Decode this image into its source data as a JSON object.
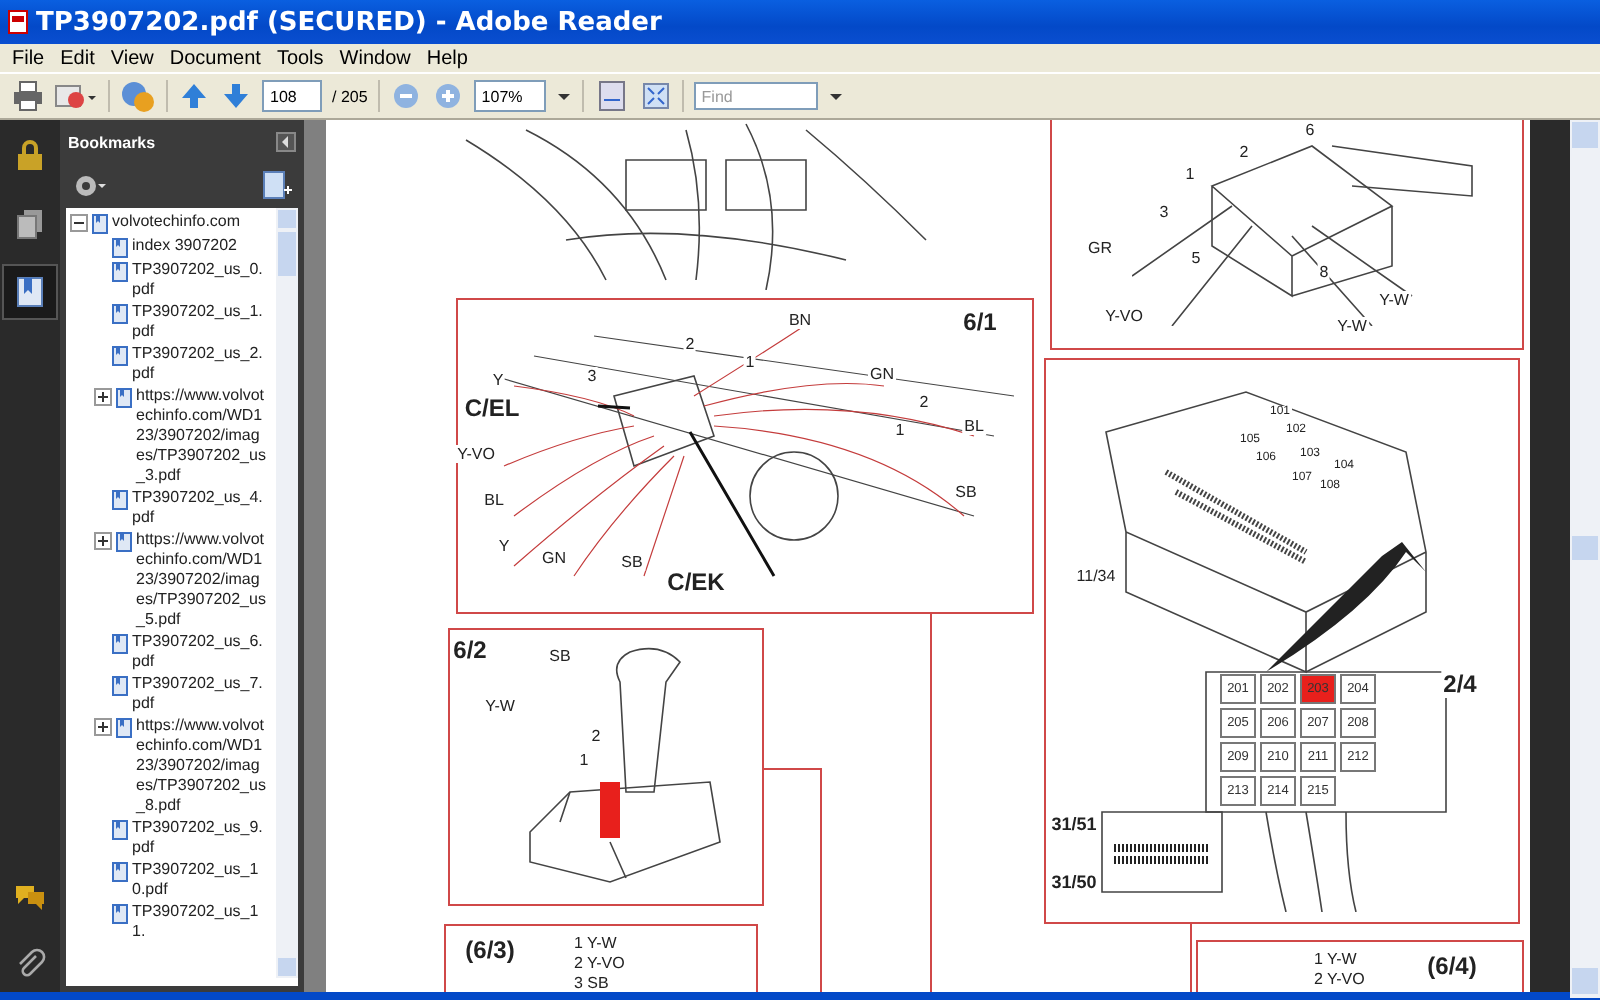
{
  "window": {
    "title": "TP3907202.pdf (SECURED) - Adobe Reader"
  },
  "menu": [
    "File",
    "Edit",
    "View",
    "Document",
    "Tools",
    "Window",
    "Help"
  ],
  "toolbar": {
    "page": "108",
    "page_count": "/ 205",
    "zoom": "107%",
    "find": {
      "placeholder": "Find"
    }
  },
  "side_tabs": [
    {
      "kind": "lock",
      "selected": false
    },
    {
      "kind": "pages",
      "selected": false
    },
    {
      "kind": "bookmarks",
      "selected": true
    },
    {
      "kind": "comments",
      "selected": false
    },
    {
      "kind": "attachments",
      "selected": false
    }
  ],
  "bookmarks": {
    "title": "Bookmarks",
    "tree": [
      {
        "label": "volvotechinfo.com",
        "expanded": true,
        "children": [
          {
            "label": "index 3907202"
          },
          {
            "label": "TP3907202_us_0.pdf"
          },
          {
            "label": "TP3907202_us_1.pdf"
          },
          {
            "label": "TP3907202_us_2.pdf"
          },
          {
            "label": "https://www.volvotechinfo.com/WD123/3907202/images/TP3907202_us_3.pdf",
            "expanded": false
          },
          {
            "label": "TP3907202_us_4.pdf"
          },
          {
            "label": "https://www.volvotechinfo.com/WD123/3907202/images/TP3907202_us_5.pdf",
            "expanded": false
          },
          {
            "label": "TP3907202_us_6.pdf"
          },
          {
            "label": "TP3907202_us_7.pdf"
          },
          {
            "label": "https://www.volvotechinfo.com/WD123/3907202/images/TP3907202_us_8.pdf",
            "expanded": false
          },
          {
            "label": "TP3907202_us_9.pdf"
          },
          {
            "label": "TP3907202_us_10.pdf"
          },
          {
            "label": "TP3907202_us_11."
          }
        ]
      }
    ]
  },
  "document": {
    "switch_figure": {
      "labels": [
        "6",
        "2",
        "1",
        "3",
        "GR",
        "5",
        "8",
        "Y-W",
        "Y-VO",
        "Y-W"
      ]
    },
    "figure_6_1": {
      "number": "6/1",
      "labels": [
        "BN",
        "2",
        "1",
        "Y",
        "3",
        "GN",
        "C/EL",
        "2",
        "BL",
        "1",
        "Y-VO",
        "BL",
        "SB",
        "Y",
        "GN",
        "SB",
        "C/EK"
      ]
    },
    "fuse_box": {
      "relays": [
        "101",
        "102",
        "105",
        "106",
        "103",
        "107",
        "104",
        "108"
      ],
      "fuses": [
        {
          "label": "201",
          "highlighted": false
        },
        {
          "label": "202",
          "highlighted": false
        },
        {
          "label": "203",
          "highlighted": true
        },
        {
          "label": "204",
          "highlighted": false
        },
        {
          "label": "205",
          "highlighted": false
        },
        {
          "label": "206",
          "highlighted": false
        },
        {
          "label": "207",
          "highlighted": false
        },
        {
          "label": "208",
          "highlighted": false
        },
        {
          "label": "209",
          "highlighted": false
        },
        {
          "label": "210",
          "highlighted": false
        },
        {
          "label": "211",
          "highlighted": false
        },
        {
          "label": "212",
          "highlighted": false
        },
        {
          "label": "213",
          "highlighted": false
        },
        {
          "label": "214",
          "highlighted": false
        },
        {
          "label": "215",
          "highlighted": false
        }
      ],
      "labels": [
        "11/34",
        "2/4",
        "31/51",
        "31/50"
      ]
    },
    "figure_6_2": {
      "number": "6/2",
      "labels": [
        "SB",
        "Y-W",
        "2",
        "1"
      ]
    },
    "figure_6_3": {
      "number": "(6/3)",
      "lines": [
        "1 Y-W",
        "2 Y-VO",
        "3 SB"
      ]
    },
    "figure_6_4": {
      "number": "(6/4)",
      "lines": [
        "1 Y-W",
        "2 Y-VO"
      ]
    }
  }
}
